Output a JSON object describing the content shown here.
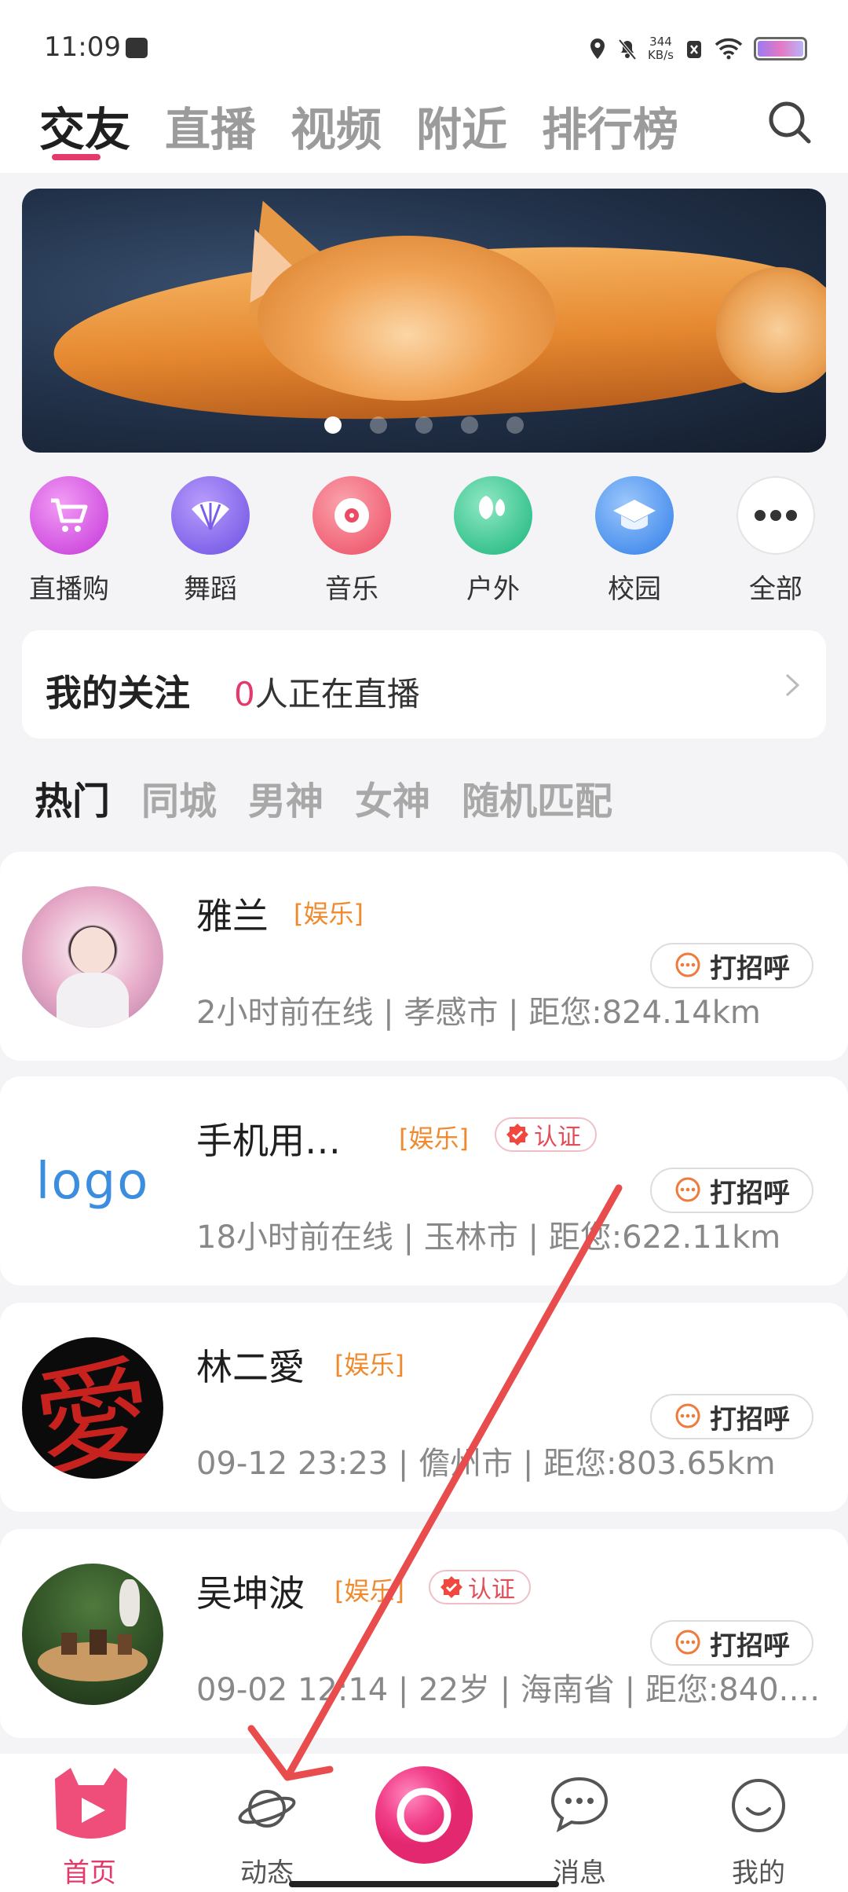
{
  "status_bar": {
    "time": "11:09",
    "net_speed": "344",
    "net_unit": "KB/s"
  },
  "top_tabs": [
    {
      "label": "交友",
      "active": true
    },
    {
      "label": "直播",
      "active": false
    },
    {
      "label": "视频",
      "active": false
    },
    {
      "label": "附近",
      "active": false
    },
    {
      "label": "排行榜",
      "active": false
    }
  ],
  "banner": {
    "slides": 5,
    "current": 1
  },
  "categories": [
    {
      "label": "直播购",
      "icon": "cart-icon",
      "color": "#d24fe0"
    },
    {
      "label": "舞蹈",
      "icon": "fan-icon",
      "color": "#8b66ef"
    },
    {
      "label": "音乐",
      "icon": "record-icon",
      "color": "#f36678"
    },
    {
      "label": "户外",
      "icon": "leaf-icon",
      "color": "#28c28c"
    },
    {
      "label": "校园",
      "icon": "graduation-cap-icon",
      "color": "#3d8cf0"
    },
    {
      "label": "全部",
      "icon": "more-icon",
      "color": "#ffffff"
    }
  ],
  "follow": {
    "title": "我的关注",
    "count": "0",
    "suffix": "人正在直播"
  },
  "sub_tabs": [
    {
      "label": "热门",
      "active": true
    },
    {
      "label": "同城",
      "active": false
    },
    {
      "label": "男神",
      "active": false
    },
    {
      "label": "女神",
      "active": false
    },
    {
      "label": "随机匹配",
      "active": false
    }
  ],
  "users": [
    {
      "name": "雅兰",
      "tag": "[娱乐]",
      "verified": false,
      "info": "2小时前在线 | 孝感市 | 距您:824.14km",
      "greet": "打招呼"
    },
    {
      "name": "手机用…",
      "tag": "[娱乐]",
      "verified": true,
      "verify_label": "认证",
      "avatar_text": "logo",
      "info": "18小时前在线 | 玉林市 | 距您:622.11km",
      "greet": "打招呼"
    },
    {
      "name": "林二愛",
      "tag": "[娱乐]",
      "verified": false,
      "avatar_text": "愛",
      "info": "09-12 23:23 | 儋州市 | 距您:803.65km",
      "greet": "打招呼"
    },
    {
      "name": "吴坤波",
      "tag": "[娱乐]",
      "verified": true,
      "verify_label": "认证",
      "info": "09-02 12:14 | 22岁 | 海南省 | 距您:840.…",
      "greet": "打招呼"
    }
  ],
  "bottom_nav": [
    {
      "label": "首页",
      "active": true
    },
    {
      "label": "动态",
      "active": false
    },
    {
      "label": "",
      "active": false
    },
    {
      "label": "消息",
      "active": false
    },
    {
      "label": "我的",
      "active": false
    }
  ],
  "colors": {
    "accent": "#e33a6b",
    "tag": "#f08a2e",
    "arrow": "#e84c4c"
  }
}
